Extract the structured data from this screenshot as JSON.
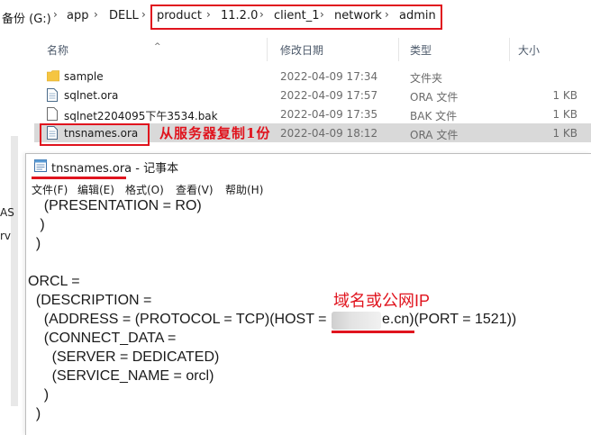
{
  "breadcrumb": {
    "items": [
      "备份 (G:)",
      "app",
      "DELL",
      "product",
      "11.2.0",
      "client_1",
      "network",
      "admin"
    ]
  },
  "columns": {
    "name": "名称",
    "modified": "修改日期",
    "type": "类型",
    "size": "大小"
  },
  "files": [
    {
      "name": "sample",
      "date": "2022-04-09 17:34",
      "type": "文件夹",
      "size": "",
      "icon": "folder-icon"
    },
    {
      "name": "sqlnet.ora",
      "date": "2022-04-09 17:57",
      "type": "ORA 文件",
      "size": "1 KB",
      "icon": "file-icon"
    },
    {
      "name": "sqlnet2204095下午3534.bak",
      "date": "2022-04-09 17:35",
      "type": "BAK 文件",
      "size": "1 KB",
      "icon": "file-icon"
    },
    {
      "name": "tnsnames.ora",
      "date": "2022-04-09 18:12",
      "type": "ORA 文件",
      "size": "1 KB",
      "icon": "file-icon"
    }
  ],
  "annotations": {
    "copy_from_server": "从服务器复制1份",
    "domain_or_ip": "域名或公网IP"
  },
  "left_fragments": [
    "AS",
    "rv"
  ],
  "notepad": {
    "title": "tnsnames.ora",
    "title_suffix": " - 记事本",
    "menu": [
      "文件(F)",
      "编辑(E)",
      "格式(O)",
      "查看(V)",
      "帮助(H)"
    ],
    "lines": [
      "    (PRESENTATION = RO)",
      "   )",
      "  )",
      "",
      "ORCL =",
      "  (DESCRIPTION =",
      "    (ADDRESS = (PROTOCOL = TCP)(HOST =",
      "    (CONNECT_DATA =",
      "      (SERVER = DEDICATED)",
      "      (SERVICE_NAME = orcl)",
      "    )",
      "  )"
    ],
    "host_visible_suffix": "e.cn)(PORT = 1521))"
  },
  "colors": {
    "annotation_red": "#e0141e",
    "selected_row": "#d9d9d9",
    "folder_yellow": "#f5c542"
  }
}
